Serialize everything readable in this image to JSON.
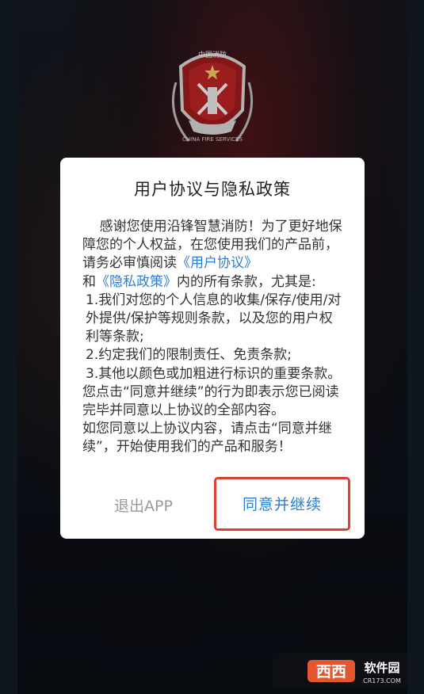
{
  "dialog": {
    "title": "用户协议与隐私政策",
    "para1_a": "感谢您使用沿锋智慧消防！为了更好地保障您的个人权益，在您使用我们的产品前，请务必审慎阅读",
    "link_user": "《用户协议》",
    "para1_and": "和",
    "link_privacy": "《隐私政策》",
    "para1_b": "内的所有条款，尤其是:",
    "item1": "1.我们对您的个人信息的收集/保存/使用/对外提供/保护等规则条款，以及您的用户权利等条款;",
    "item2": "2.约定我们的限制责任、免责条款;",
    "item3": "3.其他以颜色或加粗进行标识的重要条款。",
    "para2": "您点击“同意并继续”的行为即表示您已阅读完毕并同意以上协议的全部内容。",
    "para3": "如您同意以上协议内容，请点击“同意并继续”，开始使用我们的产品和服务！",
    "btn_exit": "退出APP",
    "btn_agree": "同意并继续"
  },
  "emblem": {
    "top_text": "中国消防",
    "ring_text": "CHINA FIRE SERVICES"
  },
  "watermark": {
    "brand": "西西",
    "site_name": "软件园",
    "url": "CR173.COM"
  },
  "colors": {
    "link": "#2b7fd9",
    "highlight_border": "#d9432f",
    "exit_text": "#9a9a9a"
  }
}
